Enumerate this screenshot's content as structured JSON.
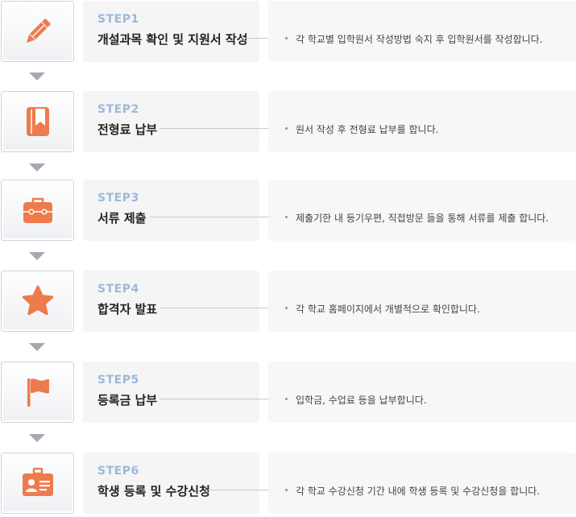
{
  "accent_color": "#ed7b4d",
  "steps": [
    {
      "step": "STEP1",
      "title": "개설과목 확인 및 지원서 작성",
      "desc": "각 학교별 입학원서 작성방법 숙지 후 입학원서를 작성합니다.",
      "icon": "pencil-icon"
    },
    {
      "step": "STEP2",
      "title": "전형료 납부",
      "desc": "원서 작성 후 전형료 납부를 합니다.",
      "icon": "bookmark-book-icon"
    },
    {
      "step": "STEP3",
      "title": "서류 제출",
      "desc": "제출기한 내 등기우편, 직접방문 들을 통해 서류를 제출 합니다.",
      "icon": "briefcase-icon"
    },
    {
      "step": "STEP4",
      "title": "합격자 발표",
      "desc": "각 학교 홈페이지에서 개별적으로 확인합니다.",
      "icon": "star-icon"
    },
    {
      "step": "STEP5",
      "title": "등록금 납부",
      "desc": "입학금, 수업료 등을 납부합니다.",
      "icon": "flag-icon"
    },
    {
      "step": "STEP6",
      "title": "학생 등록 및 수강신청",
      "desc": "각 학교 수강신청 기간 내에 학생 등록 및 수강신청을 합니다.",
      "icon": "id-card-icon"
    }
  ]
}
